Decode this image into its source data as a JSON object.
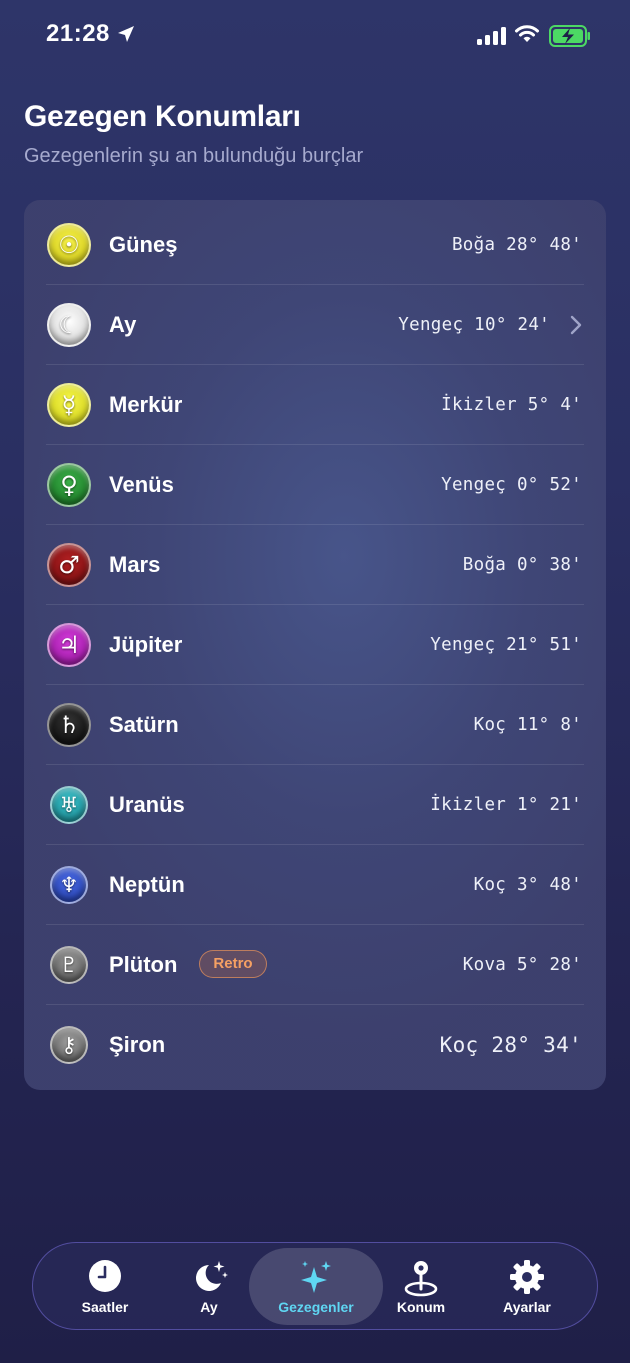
{
  "status_bar": {
    "time": "21:28"
  },
  "header": {
    "title": "Gezegen Konumları",
    "subtitle": "Gezegenlerin şu an bulunduğu burçlar"
  },
  "planets": [
    {
      "name": "Güneş",
      "position": "Boğa 28° 48'",
      "icon": "sun-icon",
      "glyph": "☉",
      "color": "#e6df16"
    },
    {
      "name": "Ay",
      "position": "Yengeç 10° 24'",
      "icon": "moon-icon",
      "glyph": "☾",
      "color": "#e8e8e8"
    },
    {
      "name": "Merkür",
      "position": "İkizler 5° 4'",
      "icon": "mercury-icon",
      "glyph": "☿",
      "color": "#e3e41a"
    },
    {
      "name": "Venüs",
      "position": "Yengeç 0° 52'",
      "icon": "venus-icon",
      "glyph": "♀",
      "color": "#1f8b2a"
    },
    {
      "name": "Mars",
      "position": "Boğa 0° 38'",
      "icon": "mars-icon",
      "glyph": "♂",
      "color": "#8c1214"
    },
    {
      "name": "Jüpiter",
      "position": "Yengeç 21° 51'",
      "icon": "jupiter-icon",
      "glyph": "♃",
      "color": "#b219b8"
    },
    {
      "name": "Satürn",
      "position": "Koç 11° 8'",
      "icon": "saturn-icon",
      "glyph": "♄",
      "color": "#111111"
    },
    {
      "name": "Uranüs",
      "position": "İkizler 1° 21'",
      "icon": "uranus-icon",
      "glyph": "♅",
      "color": "#1aa3ae"
    },
    {
      "name": "Neptün",
      "position": "Koç 3° 48'",
      "icon": "neptune-icon",
      "glyph": "♆",
      "color": "#2447c8"
    },
    {
      "name": "Plüton",
      "position": "Kova 5° 28'",
      "icon": "pluto-icon",
      "glyph": "♇",
      "color": "#6e6e6e",
      "badge": "Retro"
    },
    {
      "name": "Şiron",
      "position": "Koç 28° 34'",
      "icon": "chiron-icon",
      "glyph": "⚷",
      "color": "#7a7a7a"
    }
  ],
  "tabs": [
    {
      "label": "Saatler",
      "icon": "clock-icon",
      "active": false
    },
    {
      "label": "Ay",
      "icon": "moon-stars-icon",
      "active": false
    },
    {
      "label": "Gezegenler",
      "icon": "sparkles-icon",
      "active": true
    },
    {
      "label": "Konum",
      "icon": "map-pin-icon",
      "active": false
    },
    {
      "label": "Ayarlar",
      "icon": "gear-icon",
      "active": false
    }
  ],
  "colors": {
    "accent_active_tab": "#5fd6f2",
    "retro_badge": "#f5a063",
    "battery_charging": "#4cd964"
  }
}
